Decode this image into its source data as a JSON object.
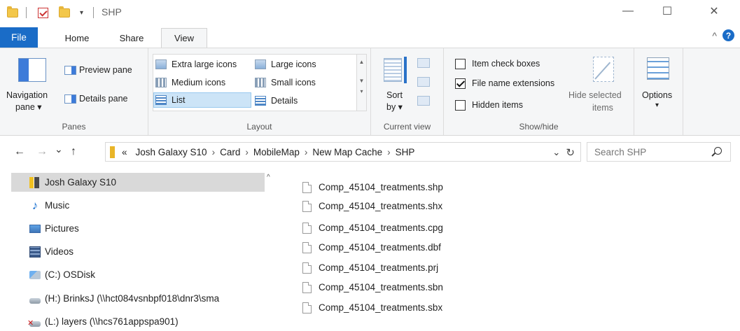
{
  "window": {
    "title": "SHP",
    "qa_dropdown": "▾",
    "minimize": "—",
    "maximize": "☐",
    "close": "✕"
  },
  "tabs": [
    {
      "label": "File"
    },
    {
      "label": "Home"
    },
    {
      "label": "Share"
    },
    {
      "label": "View"
    }
  ],
  "ribbon": {
    "collapse_chevron": "^",
    "help": "?",
    "panes": {
      "navigation_pane": "Navigation",
      "navigation_pane_2": "pane ▾",
      "preview_pane": "Preview pane",
      "details_pane": "Details pane",
      "label": "Panes"
    },
    "layout": {
      "items": [
        "Extra large icons",
        "Large icons",
        "Medium icons",
        "Small icons",
        "List",
        "Details"
      ],
      "selected": "List",
      "label": "Layout"
    },
    "current_view": {
      "sort_by": "Sort",
      "sort_by_2": "by ▾",
      "label": "Current view"
    },
    "show_hide": {
      "item_check_boxes": "Item check boxes",
      "item_check_boxes_checked": false,
      "file_name_extensions": "File name extensions",
      "file_name_extensions_checked": true,
      "hidden_items": "Hidden items",
      "hidden_items_checked": false,
      "hide_selected": "Hide selected",
      "hide_selected_2": "items",
      "label": "Show/hide"
    },
    "options": {
      "label": "Options",
      "arrow": "▾"
    }
  },
  "address": {
    "back": "←",
    "forward": "→",
    "recent": "⌄",
    "up": "↑",
    "overflow": "«",
    "breadcrumb": [
      "Josh Galaxy S10",
      "Card",
      "MobileMap",
      "New Map Cache",
      "SHP"
    ],
    "dropdown": "⌄",
    "refresh": "↻",
    "search_placeholder": "Search SHP"
  },
  "nav_pane": {
    "items": [
      {
        "label": "Josh Galaxy S10",
        "icon": "phone-icon",
        "selected": true
      },
      {
        "label": "Music",
        "icon": "music-icon"
      },
      {
        "label": "Pictures",
        "icon": "pictures-icon"
      },
      {
        "label": "Videos",
        "icon": "videos-icon"
      },
      {
        "label": "(C:) OSDisk",
        "icon": "disk-icon"
      },
      {
        "label": "(H:) BrinksJ (\\\\hct084vsnbpf018\\dnr3\\sma",
        "icon": "network-drive-icon"
      },
      {
        "label": "(L:) layers (\\\\hcs761appspa901)",
        "icon": "network-drive-disconnected-icon"
      }
    ]
  },
  "files": [
    {
      "name": "Comp_45104_treatments.shp"
    },
    {
      "name": "Comp_45104_treatments.shx"
    },
    {
      "name": "Comp_45104_treatments.cpg"
    },
    {
      "name": "Comp_45104_treatments.dbf"
    },
    {
      "name": "Comp_45104_treatments.prj"
    },
    {
      "name": "Comp_45104_treatments.sbn"
    },
    {
      "name": "Comp_45104_treatments.sbx"
    }
  ]
}
